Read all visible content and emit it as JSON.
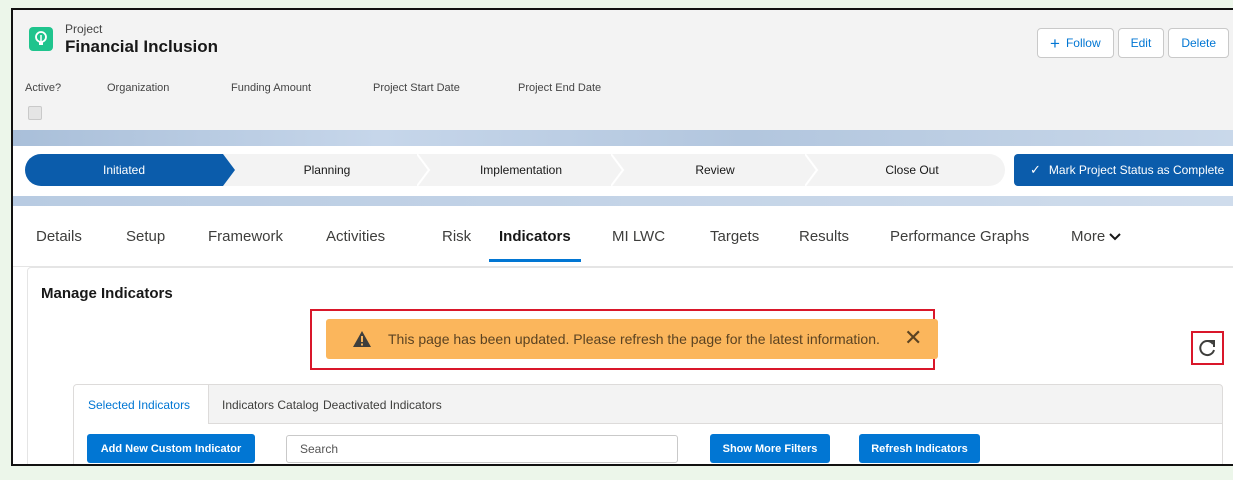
{
  "header": {
    "object_type": "Project",
    "record_name": "Financial Inclusion",
    "buttons": {
      "follow": "Follow",
      "edit": "Edit",
      "delete": "Delete"
    },
    "highlights": [
      {
        "label": "Active?"
      },
      {
        "label": "Organization"
      },
      {
        "label": "Funding Amount"
      },
      {
        "label": "Project Start Date"
      },
      {
        "label": "Project End Date"
      }
    ]
  },
  "path": {
    "steps": [
      "Initiated",
      "Planning",
      "Implementation",
      "Review",
      "Close Out"
    ],
    "active_step": "Initiated",
    "mark_button": "Mark Project Status as Complete"
  },
  "tabs": {
    "items": [
      "Details",
      "Setup",
      "Framework",
      "Activities",
      "Risk",
      "Indicators",
      "MI LWC",
      "Targets",
      "Results",
      "Performance Graphs",
      "More"
    ],
    "active": "Indicators"
  },
  "card": {
    "title": "Manage Indicators",
    "toast": "This page has been updated. Please refresh the page for the latest information.",
    "inner_tabs": [
      "Selected Indicators",
      "Indicators Catalog",
      "Deactivated Indicators"
    ],
    "inner_active": "Selected Indicators",
    "add_button": "Add New Custom Indicator",
    "search_placeholder": "Search",
    "filters_button": "Show More Filters",
    "refresh_button": "Refresh Indicators"
  },
  "colors": {
    "brand": "#0176d3",
    "path_active": "#0b5cab",
    "toast_bg": "#fbb65c",
    "highlight_border": "#d9172a",
    "object_icon": "#1fc48d"
  },
  "icons": [
    "lightbulb-icon",
    "plus-icon",
    "check-icon",
    "warning-icon",
    "close-icon",
    "refresh-icon",
    "chevron-down-icon"
  ]
}
